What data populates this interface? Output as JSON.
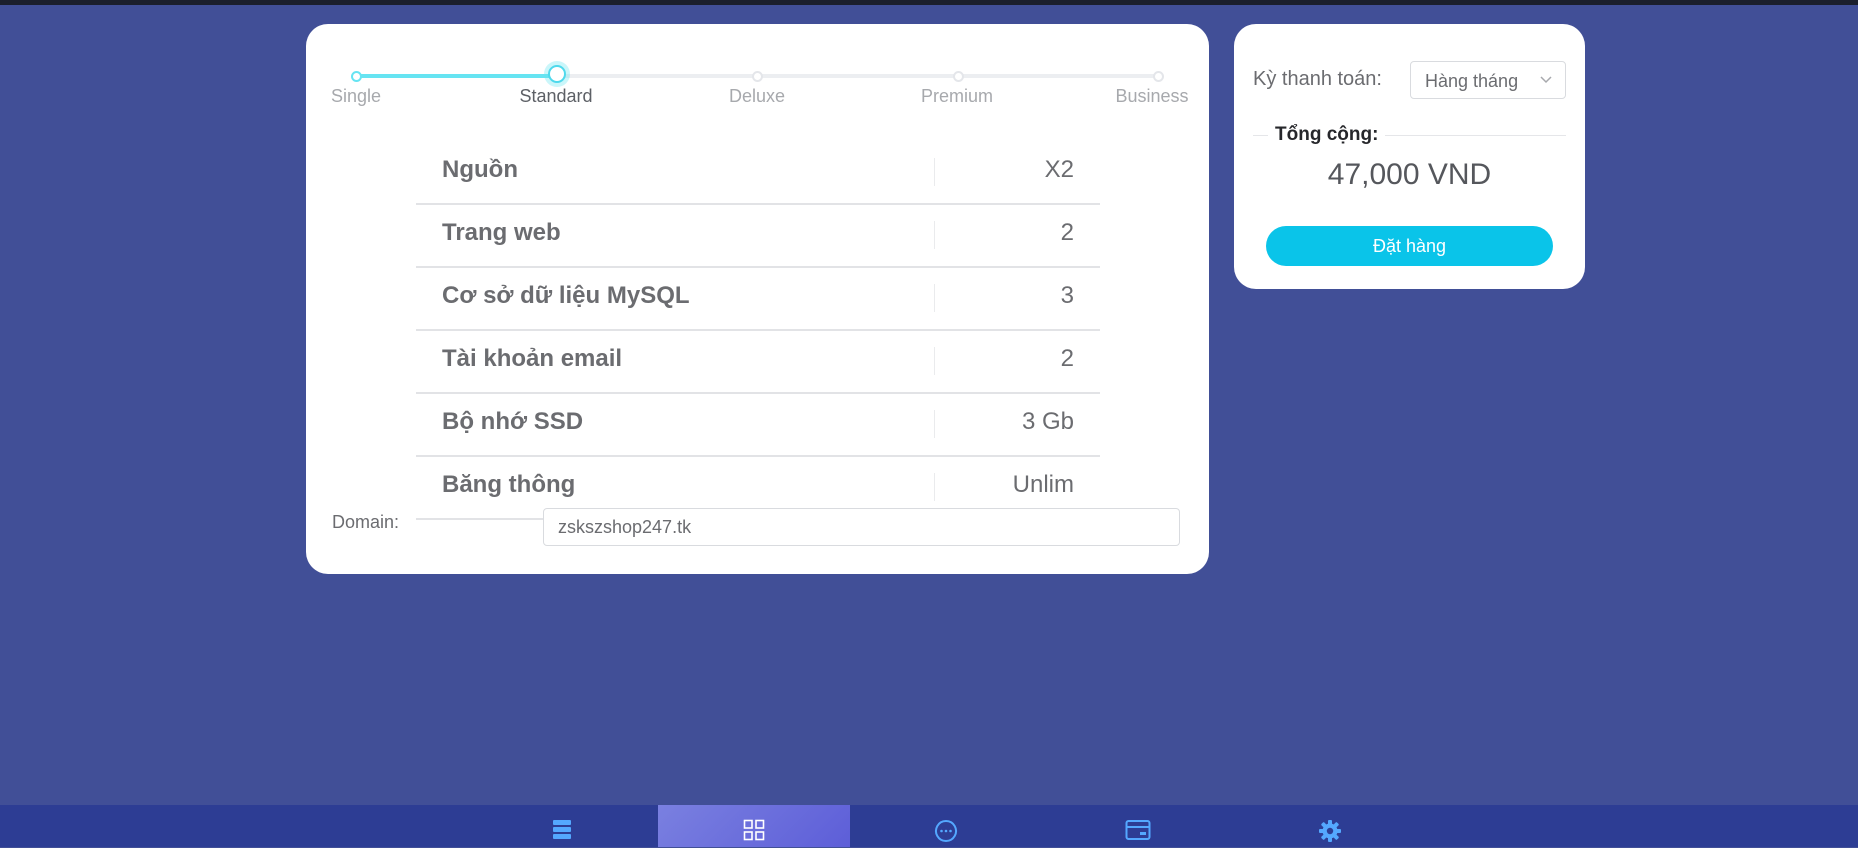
{
  "plans": {
    "labels": [
      "Single",
      "Standard",
      "Deluxe",
      "Premium",
      "Business"
    ],
    "selected_index": 1
  },
  "specs": [
    {
      "name": "Nguồn",
      "value": "X2"
    },
    {
      "name": "Trang web",
      "value": "2"
    },
    {
      "name": "Cơ sở dữ liệu MySQL",
      "value": "3"
    },
    {
      "name": "Tài khoản email",
      "value": "2"
    },
    {
      "name": "Bộ nhớ SSD",
      "value": "3 Gb"
    },
    {
      "name": "Băng thông",
      "value": "Unlim"
    }
  ],
  "domain": {
    "label": "Domain:",
    "value": "zskszshop247.tk"
  },
  "billing": {
    "label": "Kỳ thanh toán:",
    "selected": "Hàng tháng"
  },
  "total": {
    "label": "Tổng cộng:",
    "value": "47,000 VND"
  },
  "order_button": "Đặt hàng",
  "bottom_nav": [
    {
      "icon": "server-icon",
      "active": false
    },
    {
      "icon": "grid-icon",
      "active": true
    },
    {
      "icon": "chat-icon",
      "active": false
    },
    {
      "icon": "card-icon",
      "active": false
    },
    {
      "icon": "gear-icon",
      "active": false
    }
  ],
  "colors": {
    "background": "#414f97",
    "accent": "#0ac4e9",
    "slider": "#66e4f2",
    "nav": "#2d3d94",
    "nav_active": "#6b6fdc"
  }
}
